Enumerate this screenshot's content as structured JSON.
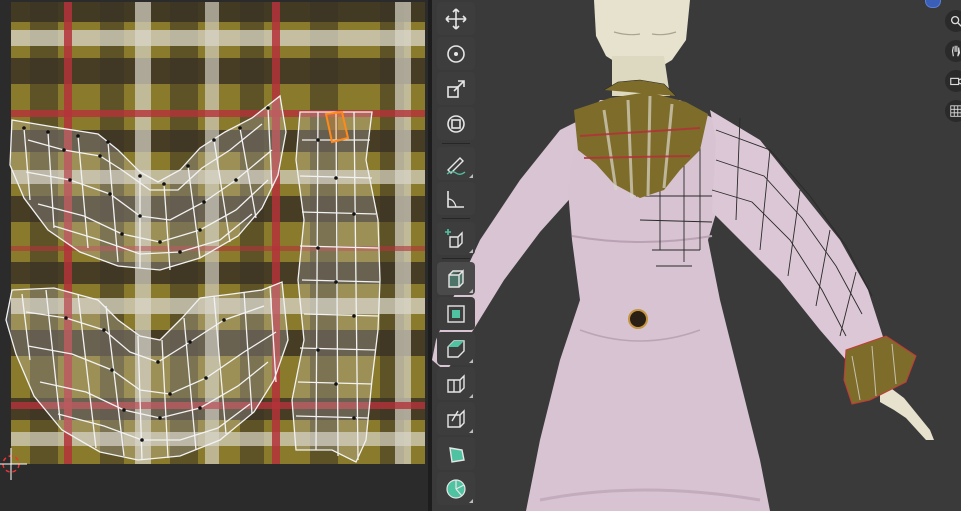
{
  "app": {
    "name": ""
  },
  "colors": {
    "uv_background": "#2b2b2b",
    "viewport_background": "#3a3a3a",
    "toolbar_button": "#3d3d3d",
    "tartan_base": "#8a7a2c",
    "tartan_dark": "#3a3220",
    "tartan_stripe_light": "#d9d6c8",
    "tartan_stripe_red": "#b4323a",
    "uv_edge": "#f2f2f2",
    "uv_vertex": "#111111",
    "uv_selected": "#ff8a1c",
    "dress_color": "#d8c3d2",
    "skin_color": "#e6e2cd"
  },
  "uv_editor": {
    "name": "uv-editor",
    "cursor_icon": "2d-cursor-icon"
  },
  "viewport": {
    "name": "3d-viewport",
    "object": "dress-model",
    "navigation": [
      {
        "name": "zoom-icon"
      },
      {
        "name": "pan-hand-icon"
      },
      {
        "name": "camera-icon"
      },
      {
        "name": "grid-ortho-icon"
      }
    ]
  },
  "toolbar": {
    "tools": [
      {
        "name": "move-tool",
        "icon": "move-arrows-icon",
        "active": false
      },
      {
        "name": "rotate-tool",
        "icon": "rotate-icon",
        "active": false
      },
      {
        "name": "scale-tool",
        "icon": "scale-icon",
        "active": false
      },
      {
        "name": "transform-tool",
        "icon": "transform-icon",
        "active": false
      },
      {
        "name": "annotate-tool",
        "icon": "annotate-pen-icon",
        "active": false
      },
      {
        "name": "measure-tool",
        "icon": "measure-ruler-icon",
        "active": false
      },
      {
        "name": "add-cube-tool",
        "icon": "add-cube-icon",
        "active": false
      },
      {
        "name": "extrude-tool",
        "icon": "extrude-region-icon",
        "active": true
      },
      {
        "name": "inset-tool",
        "icon": "inset-faces-icon",
        "active": false
      },
      {
        "name": "bevel-tool",
        "icon": "bevel-icon",
        "active": false
      },
      {
        "name": "loop-cut-tool",
        "icon": "loop-cut-icon",
        "active": false
      },
      {
        "name": "knife-tool",
        "icon": "knife-icon",
        "active": false
      },
      {
        "name": "poly-build-tool",
        "icon": "poly-build-icon",
        "active": false
      },
      {
        "name": "spin-tool",
        "icon": "spin-icon",
        "active": false
      }
    ]
  }
}
